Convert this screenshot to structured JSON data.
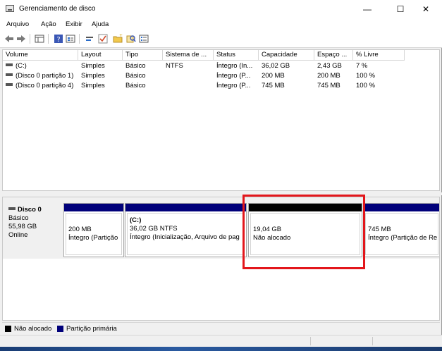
{
  "window": {
    "title": "Gerenciamento de disco",
    "controls": {
      "minimize": "—",
      "maximize": "☐",
      "close": "✕"
    }
  },
  "menu": [
    "Arquivo",
    "Ação",
    "Exibir",
    "Ajuda"
  ],
  "toolbar": {
    "icons": [
      "back-arrow-icon",
      "forward-arrow-icon",
      "grid-view-icon",
      "help-icon",
      "properties-icon",
      "connect-icon",
      "check-icon",
      "folder-icon",
      "search-icon",
      "list-icon"
    ]
  },
  "volume_list": {
    "columns": [
      "Volume",
      "Layout",
      "Tipo",
      "Sistema de ...",
      "Status",
      "Capacidade",
      "Espaço ...",
      "% Livre"
    ],
    "rows": [
      [
        "(C:)",
        "Simples",
        "Básico",
        "NTFS",
        "Íntegro (In...",
        "36,02 GB",
        "2,43 GB",
        "7 %"
      ],
      [
        "(Disco 0 partição 1)",
        "Simples",
        "Básico",
        "",
        "Íntegro (P...",
        "200 MB",
        "200 MB",
        "100 %"
      ],
      [
        "(Disco 0 partição 4)",
        "Simples",
        "Básico",
        "",
        "Íntegro (P...",
        "745 MB",
        "745 MB",
        "100 %"
      ]
    ]
  },
  "disk": {
    "name": "Disco 0",
    "type": "Básico",
    "size": "55,98 GB",
    "status": "Online",
    "partitions": [
      {
        "name": "",
        "size": "200 MB",
        "desc": "Íntegro (Partição",
        "kind": "primary"
      },
      {
        "name": "(C:)",
        "size": "36,02 GB NTFS",
        "desc": "Íntegro (Inicialização, Arquivo de pag",
        "kind": "primary"
      },
      {
        "name": "",
        "size": "19,04 GB",
        "desc": "Não alocado",
        "kind": "unallocated"
      },
      {
        "name": "",
        "size": "745 MB",
        "desc": "Íntegro (Partição de Re",
        "kind": "primary"
      }
    ]
  },
  "legend": [
    {
      "label": "Não alocado",
      "color": "#000000"
    },
    {
      "label": "Partição primária",
      "color": "#00007a"
    }
  ],
  "colors": {
    "highlight": "#e3161b",
    "primary_bar": "#00007a",
    "unallocated_bar": "#000000"
  }
}
